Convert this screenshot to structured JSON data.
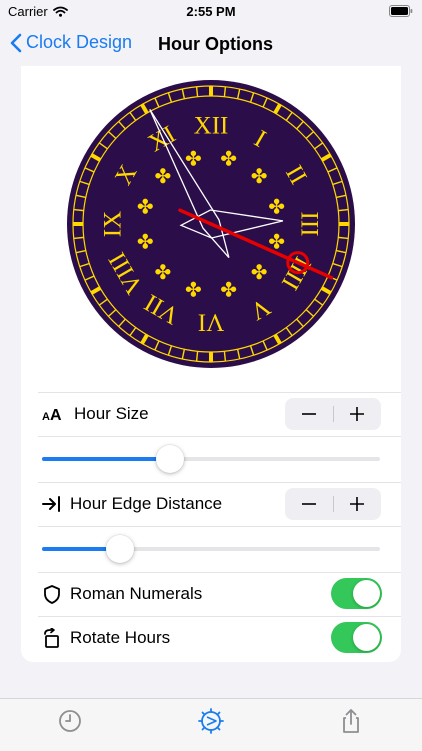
{
  "status": {
    "carrier": "Carrier",
    "time": "2:55 PM"
  },
  "nav": {
    "back_label": "Clock Design",
    "title": "Hour Options"
  },
  "clock": {
    "face_color": "#2b0d4a",
    "numeral_color": "#ffd800",
    "hand_color": "#ffffff",
    "second_hand_color": "#e60000",
    "numerals": [
      "XII",
      "I",
      "II",
      "III",
      "IIII",
      "V",
      "VI",
      "VII",
      "VIII",
      "IX",
      "X",
      "XI"
    ],
    "time": {
      "hour": 2,
      "minute": 55,
      "second": 19
    }
  },
  "rows": {
    "hour_size": {
      "label": "Hour Size",
      "icon": "text-size-icon",
      "slider_value": 0.38
    },
    "hour_edge_distance": {
      "label": "Hour Edge Distance",
      "icon": "arrow-to-edge-icon",
      "slider_value": 0.23
    },
    "roman_numerals": {
      "label": "Roman Numerals",
      "icon": "shield-icon",
      "on": true
    },
    "rotate_hours": {
      "label": "Rotate Hours",
      "icon": "rotate-icon",
      "on": true
    }
  },
  "stepper": {
    "minus": "−",
    "plus": "+"
  },
  "tabs": [
    {
      "name": "clock-icon",
      "selected": false
    },
    {
      "name": "design-icon",
      "selected": true
    },
    {
      "name": "share-icon",
      "selected": false
    }
  ],
  "colors": {
    "accent": "#1a7cf0",
    "toggle_on": "#34c759",
    "tab_inactive": "#8e8e93"
  }
}
